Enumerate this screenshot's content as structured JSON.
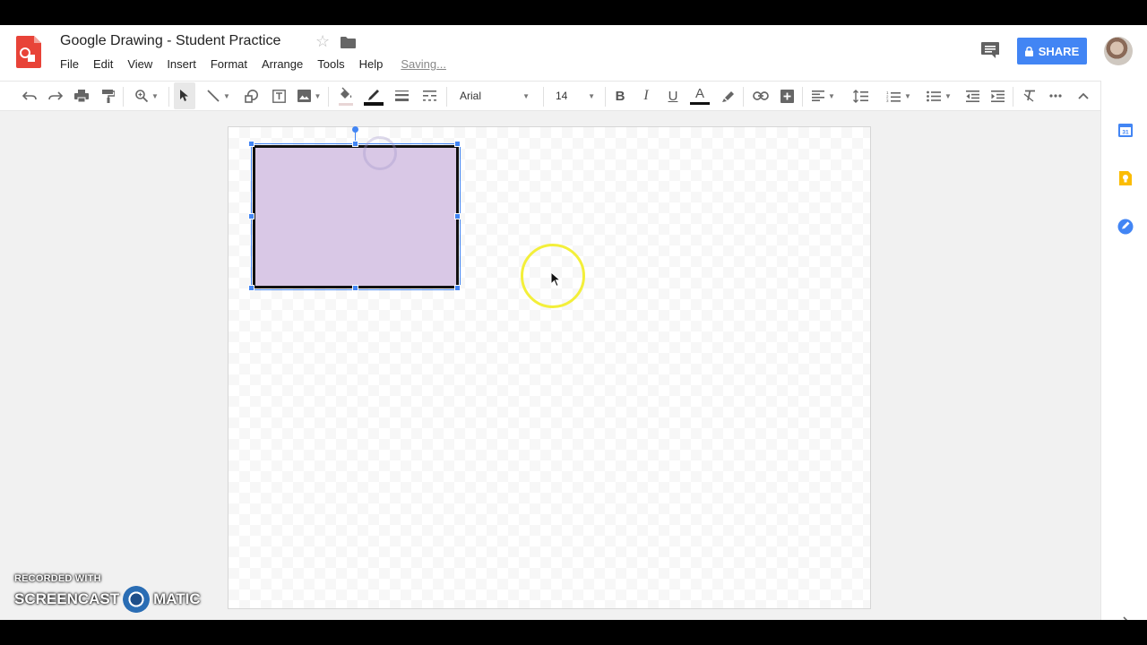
{
  "window": {
    "title": "Google Drawing - Student Practice",
    "saving_status": "Saving..."
  },
  "menu": [
    "File",
    "Edit",
    "View",
    "Insert",
    "Format",
    "Arrange",
    "Tools",
    "Help"
  ],
  "share": {
    "label": "SHARE"
  },
  "toolbar": {
    "font_name": "Arial",
    "font_size": "14",
    "bold": "B",
    "italic": "I",
    "underline": "U",
    "text_color": "A"
  },
  "colors": {
    "shape_fill": "#d9c8e6",
    "shape_border": "#111111",
    "share_button": "#4285f4",
    "selection": "#4285f4",
    "cursor_highlight": "#f3ef3a"
  },
  "icons": {
    "app": "google-drawings-icon",
    "side_panel": [
      "calendar-icon",
      "keep-icon",
      "tasks-icon"
    ]
  },
  "side_panel": {
    "calendar_day": "31"
  },
  "watermark": {
    "line1": "RECORDED WITH",
    "line2_left": "SCREENCAST",
    "line2_right": "MATIC"
  }
}
